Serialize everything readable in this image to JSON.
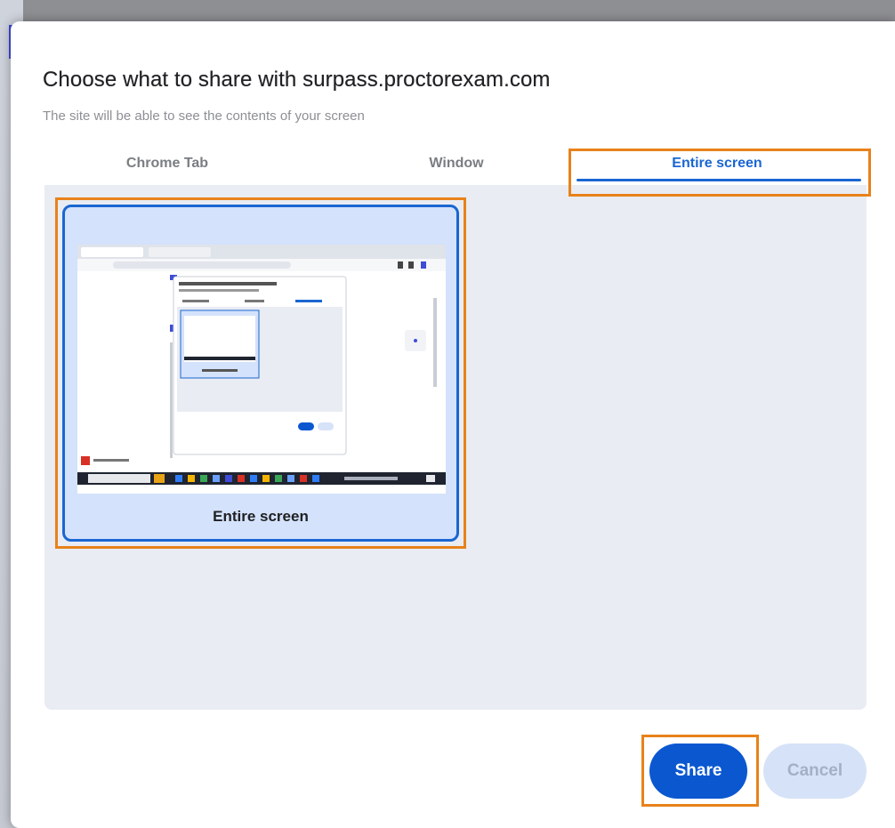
{
  "dialog": {
    "title": "Choose what to share with surpass.proctorexam.com",
    "subtitle": "The site will be able to see the contents of your screen"
  },
  "tabs": [
    {
      "label": "Chrome Tab",
      "selected": false
    },
    {
      "label": "Window",
      "selected": false
    },
    {
      "label": "Entire screen",
      "selected": true
    }
  ],
  "sources": [
    {
      "label": "Entire screen",
      "selected": true
    }
  ],
  "buttons": {
    "share_label": "Share",
    "cancel_label": "Cancel"
  },
  "colors": {
    "accent": "#1a66d2",
    "primary_button": "#0b57d0",
    "highlight_outline": "#e8821a",
    "panel_background": "#e9ecf3",
    "thumbnail_background": "#d4e2fb"
  }
}
